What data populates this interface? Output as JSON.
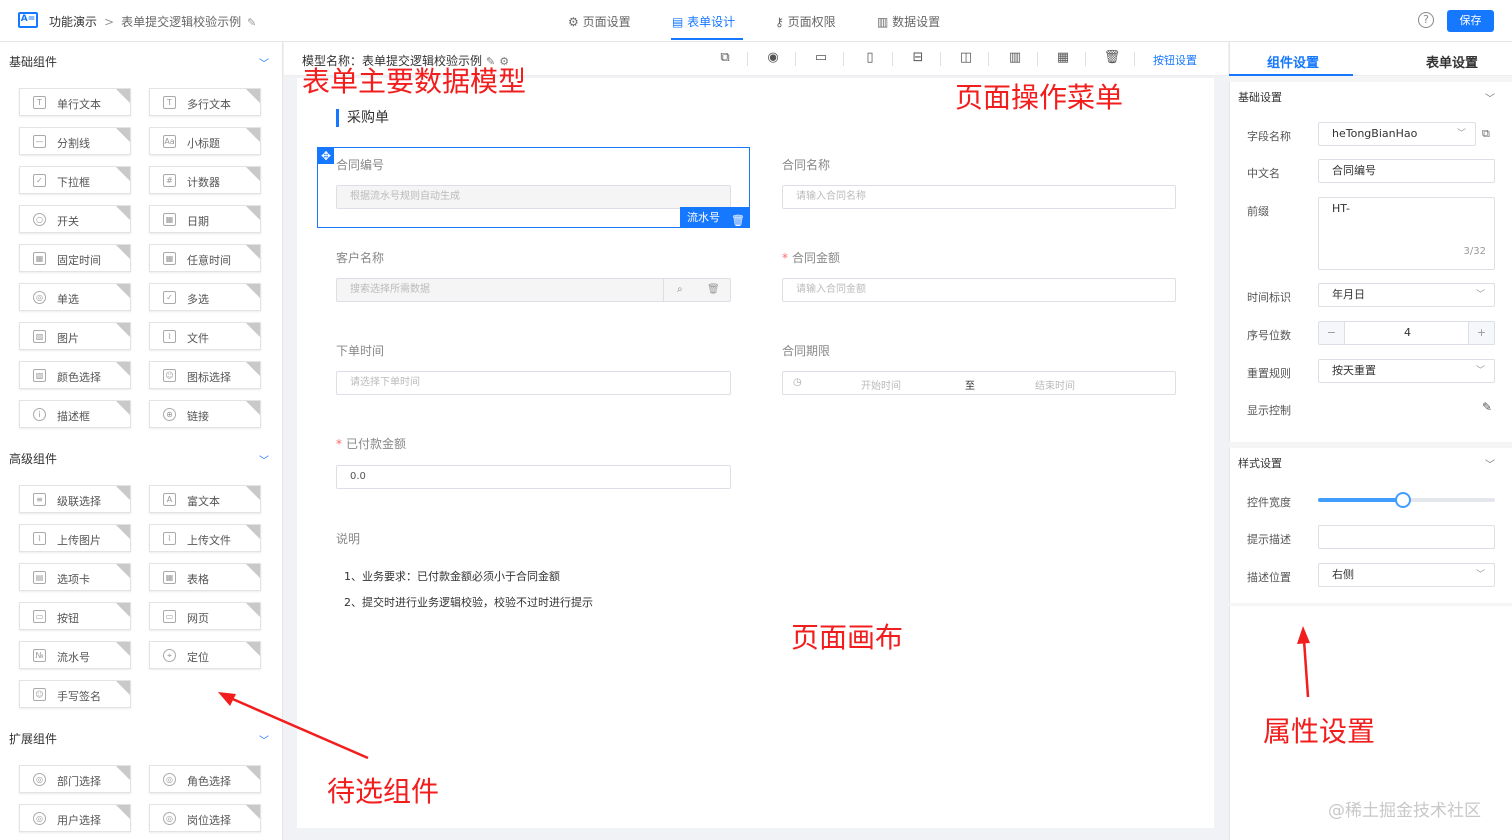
{
  "topbar": {
    "app_title": "功能演示",
    "crumb_sep": ">",
    "form_name": "表单提交逻辑校验示例",
    "tabs": [
      {
        "icon": "⚙",
        "label": "页面设置"
      },
      {
        "icon": "▤",
        "label": "表单设计"
      },
      {
        "icon": "⚷",
        "label": "页面权限"
      },
      {
        "icon": "▥",
        "label": "数据设置"
      }
    ],
    "active_tab": "表单设计",
    "help": "?",
    "save_label": "保存"
  },
  "left": {
    "groups": [
      {
        "title": "基础组件",
        "items": [
          {
            "label": "单行文本",
            "icon": "text-input-icon"
          },
          {
            "label": "多行文本",
            "icon": "textarea-icon"
          },
          {
            "label": "分割线",
            "icon": "divider-icon"
          },
          {
            "label": "小标题",
            "icon": "subtitle-icon"
          },
          {
            "label": "下拉框",
            "icon": "dropdown-icon"
          },
          {
            "label": "计数器",
            "icon": "counter-icon"
          },
          {
            "label": "开关",
            "icon": "switch-icon"
          },
          {
            "label": "日期",
            "icon": "calendar-icon"
          },
          {
            "label": "固定时间",
            "icon": "calendar-icon"
          },
          {
            "label": "任意时间",
            "icon": "calendar-icon"
          },
          {
            "label": "单选",
            "icon": "radio-icon"
          },
          {
            "label": "多选",
            "icon": "checkbox-icon"
          },
          {
            "label": "图片",
            "icon": "image-icon"
          },
          {
            "label": "文件",
            "icon": "paperclip-icon"
          },
          {
            "label": "颜色选择",
            "icon": "color-icon"
          },
          {
            "label": "图标选择",
            "icon": "user-icon"
          },
          {
            "label": "描述框",
            "icon": "info-icon"
          },
          {
            "label": "链接",
            "icon": "globe-icon"
          }
        ]
      },
      {
        "title": "高级组件",
        "items": [
          {
            "label": "级联选择",
            "icon": "cascade-icon"
          },
          {
            "label": "富文本",
            "icon": "richtext-icon"
          },
          {
            "label": "上传图片",
            "icon": "paperclip-icon"
          },
          {
            "label": "上传文件",
            "icon": "paperclip-icon"
          },
          {
            "label": "选项卡",
            "icon": "tabs-icon"
          },
          {
            "label": "表格",
            "icon": "table-icon"
          },
          {
            "label": "按钮",
            "icon": "button-icon"
          },
          {
            "label": "网页",
            "icon": "webpage-icon"
          },
          {
            "label": "流水号",
            "icon": "serial-icon"
          },
          {
            "label": "定位",
            "icon": "location-pin-icon"
          },
          {
            "label": "手写签名",
            "icon": "user-icon"
          }
        ]
      },
      {
        "title": "扩展组件",
        "items": [
          {
            "label": "部门选择",
            "icon": "circle-icon"
          },
          {
            "label": "角色选择",
            "icon": "circle-icon"
          },
          {
            "label": "用户选择",
            "icon": "circle-icon"
          },
          {
            "label": "岗位选择",
            "icon": "circle-icon"
          }
        ]
      }
    ]
  },
  "canvas": {
    "model_name": "模型名称：表单提交逻辑校验示例",
    "button_setting": "按钮设置",
    "form_title": "采购单",
    "fields": {
      "contract_no": {
        "label": "合同编号",
        "placeholder": "根据流水号规则自动生成"
      },
      "contract_name": {
        "label": "合同名称",
        "placeholder": "请输入合同名称"
      },
      "customer": {
        "label": "客户名称",
        "placeholder": "搜索选择所需数据"
      },
      "amount": {
        "label": "合同金额",
        "placeholder": "请输入合同金额",
        "required": "*"
      },
      "order_time": {
        "label": "下单时间",
        "placeholder": "请选择下单时间"
      },
      "period": {
        "label": "合同期限",
        "start": "开始时间",
        "to": "至",
        "end": "结束时间"
      },
      "paid": {
        "label": "已付款金额",
        "value": "0.0",
        "required": "*"
      }
    },
    "selected_tag": "流水号",
    "description": {
      "label": "说明",
      "lines": [
        "1、业务要求：已付款金额必须小于合同金额",
        "2、提交时进行业务逻辑校验，校验不过时进行提示"
      ]
    }
  },
  "annotations": {
    "model": "表单主要数据模型",
    "menu": "页面操作菜单",
    "canvas": "页面画布",
    "components": "待选组件",
    "props": "属性设置"
  },
  "right": {
    "tabs": [
      "组件设置",
      "表单设置"
    ],
    "basic_title": "基础设置",
    "field_name": {
      "label": "字段名称",
      "value": "heTongBianHao"
    },
    "cn_name": {
      "label": "中文名",
      "value": "合同编号"
    },
    "prefix": {
      "label": "前缀",
      "value": "HT-",
      "count": "3/32"
    },
    "time_mark": {
      "label": "时间标识",
      "value": "年月日"
    },
    "seq_digits": {
      "label": "序号位数",
      "value": "4",
      "minus": "−",
      "plus": "+"
    },
    "reset_rule": {
      "label": "重置规则",
      "value": "按天重置"
    },
    "display_ctrl": {
      "label": "显示控制"
    },
    "style_title": "样式设置",
    "control_width": {
      "label": "控件宽度",
      "fraction": 0.48
    },
    "hint_desc": {
      "label": "提示描述",
      "value": ""
    },
    "desc_pos": {
      "label": "描述位置",
      "value": "右侧"
    }
  },
  "watermark": "@稀土掘金技术社区",
  "colors": {
    "accent": "#1677ff",
    "annotation": "#f21d1d"
  }
}
